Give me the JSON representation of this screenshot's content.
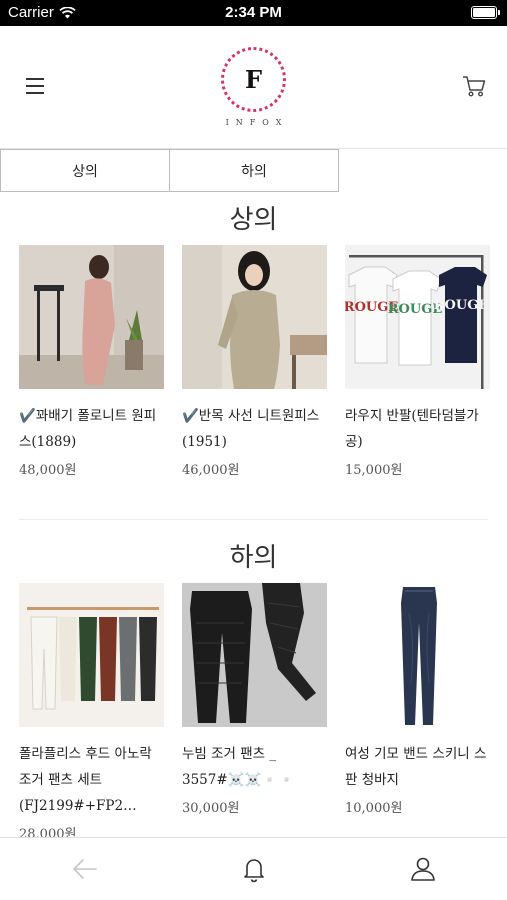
{
  "status_bar": {
    "carrier": "Carrier",
    "time": "2:34 PM"
  },
  "header": {
    "logo_letter": "F",
    "logo_wordmark": "INFOX"
  },
  "tabs": [
    {
      "label": "상의"
    },
    {
      "label": "하의"
    }
  ],
  "sections": [
    {
      "title": "상의",
      "products": [
        {
          "name": "✔️꽈배기 폴로니트 원피스(1889)",
          "price": "48,000원",
          "image": "pink-knit-dress"
        },
        {
          "name": "✔️반목 사선 니트원피스 (1951)",
          "price": "46,000원",
          "image": "beige-knit-dress"
        },
        {
          "name": "라우지 반팔(텐타덤블가공)",
          "price": "15,000원",
          "image": "rouge-tshirts"
        }
      ]
    },
    {
      "title": "하의",
      "products": [
        {
          "name": "폴라플리스 후드 아노락 조거 팬츠 세트(FJ2199#+FP2…",
          "price": "28,000원",
          "image": "jogger-pants-rack"
        },
        {
          "name": "누빔 조거 팬츠 _ 3557#☠️☠️▫️▫️",
          "price": "30,000원",
          "image": "black-quilted-pants"
        },
        {
          "name": "여성 기모 밴드 스키니 스판 청바지",
          "price": "10,000원",
          "image": "skinny-jeans"
        }
      ]
    }
  ],
  "colors": {
    "logo_ring": "#d6336c",
    "border": "#bdbdbd"
  },
  "tabbar_icons": [
    "back-arrow-icon",
    "bell-icon",
    "user-icon"
  ]
}
